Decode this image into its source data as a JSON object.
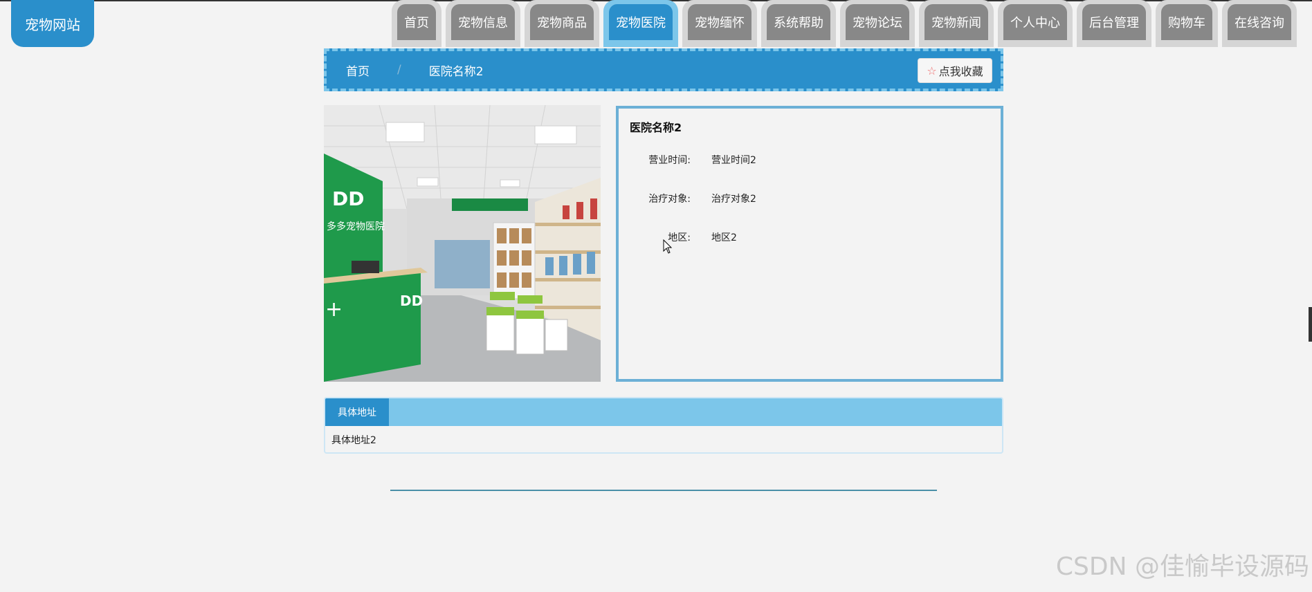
{
  "logo": {
    "text": "宠物网站"
  },
  "nav": {
    "items": [
      {
        "label": "首页"
      },
      {
        "label": "宠物信息"
      },
      {
        "label": "宠物商品"
      },
      {
        "label": "宠物医院",
        "active": true
      },
      {
        "label": "宠物缅怀"
      },
      {
        "label": "系统帮助"
      },
      {
        "label": "宠物论坛"
      },
      {
        "label": "宠物新闻"
      },
      {
        "label": "个人中心"
      },
      {
        "label": "后台管理"
      },
      {
        "label": "购物车"
      },
      {
        "label": "在线咨询"
      }
    ]
  },
  "breadcrumb": {
    "home": "首页",
    "separator": "/",
    "current": "医院名称2",
    "favorite_label": "点我收藏"
  },
  "detail": {
    "title": "医院名称2",
    "fields": [
      {
        "label": "营业时间:",
        "value": "营业时间2"
      },
      {
        "label": "治疗对象:",
        "value": "治疗对象2"
      },
      {
        "label": "地区:",
        "value": "地区2"
      }
    ]
  },
  "address": {
    "tab_label": "具体地址",
    "content": "具体地址2"
  },
  "watermark": "CSDN @佳愉毕设源码",
  "colors": {
    "primary": "#2a8fcb",
    "light": "#7cc6ea",
    "tab_gray": "#888888",
    "background": "#f3f3f3"
  }
}
